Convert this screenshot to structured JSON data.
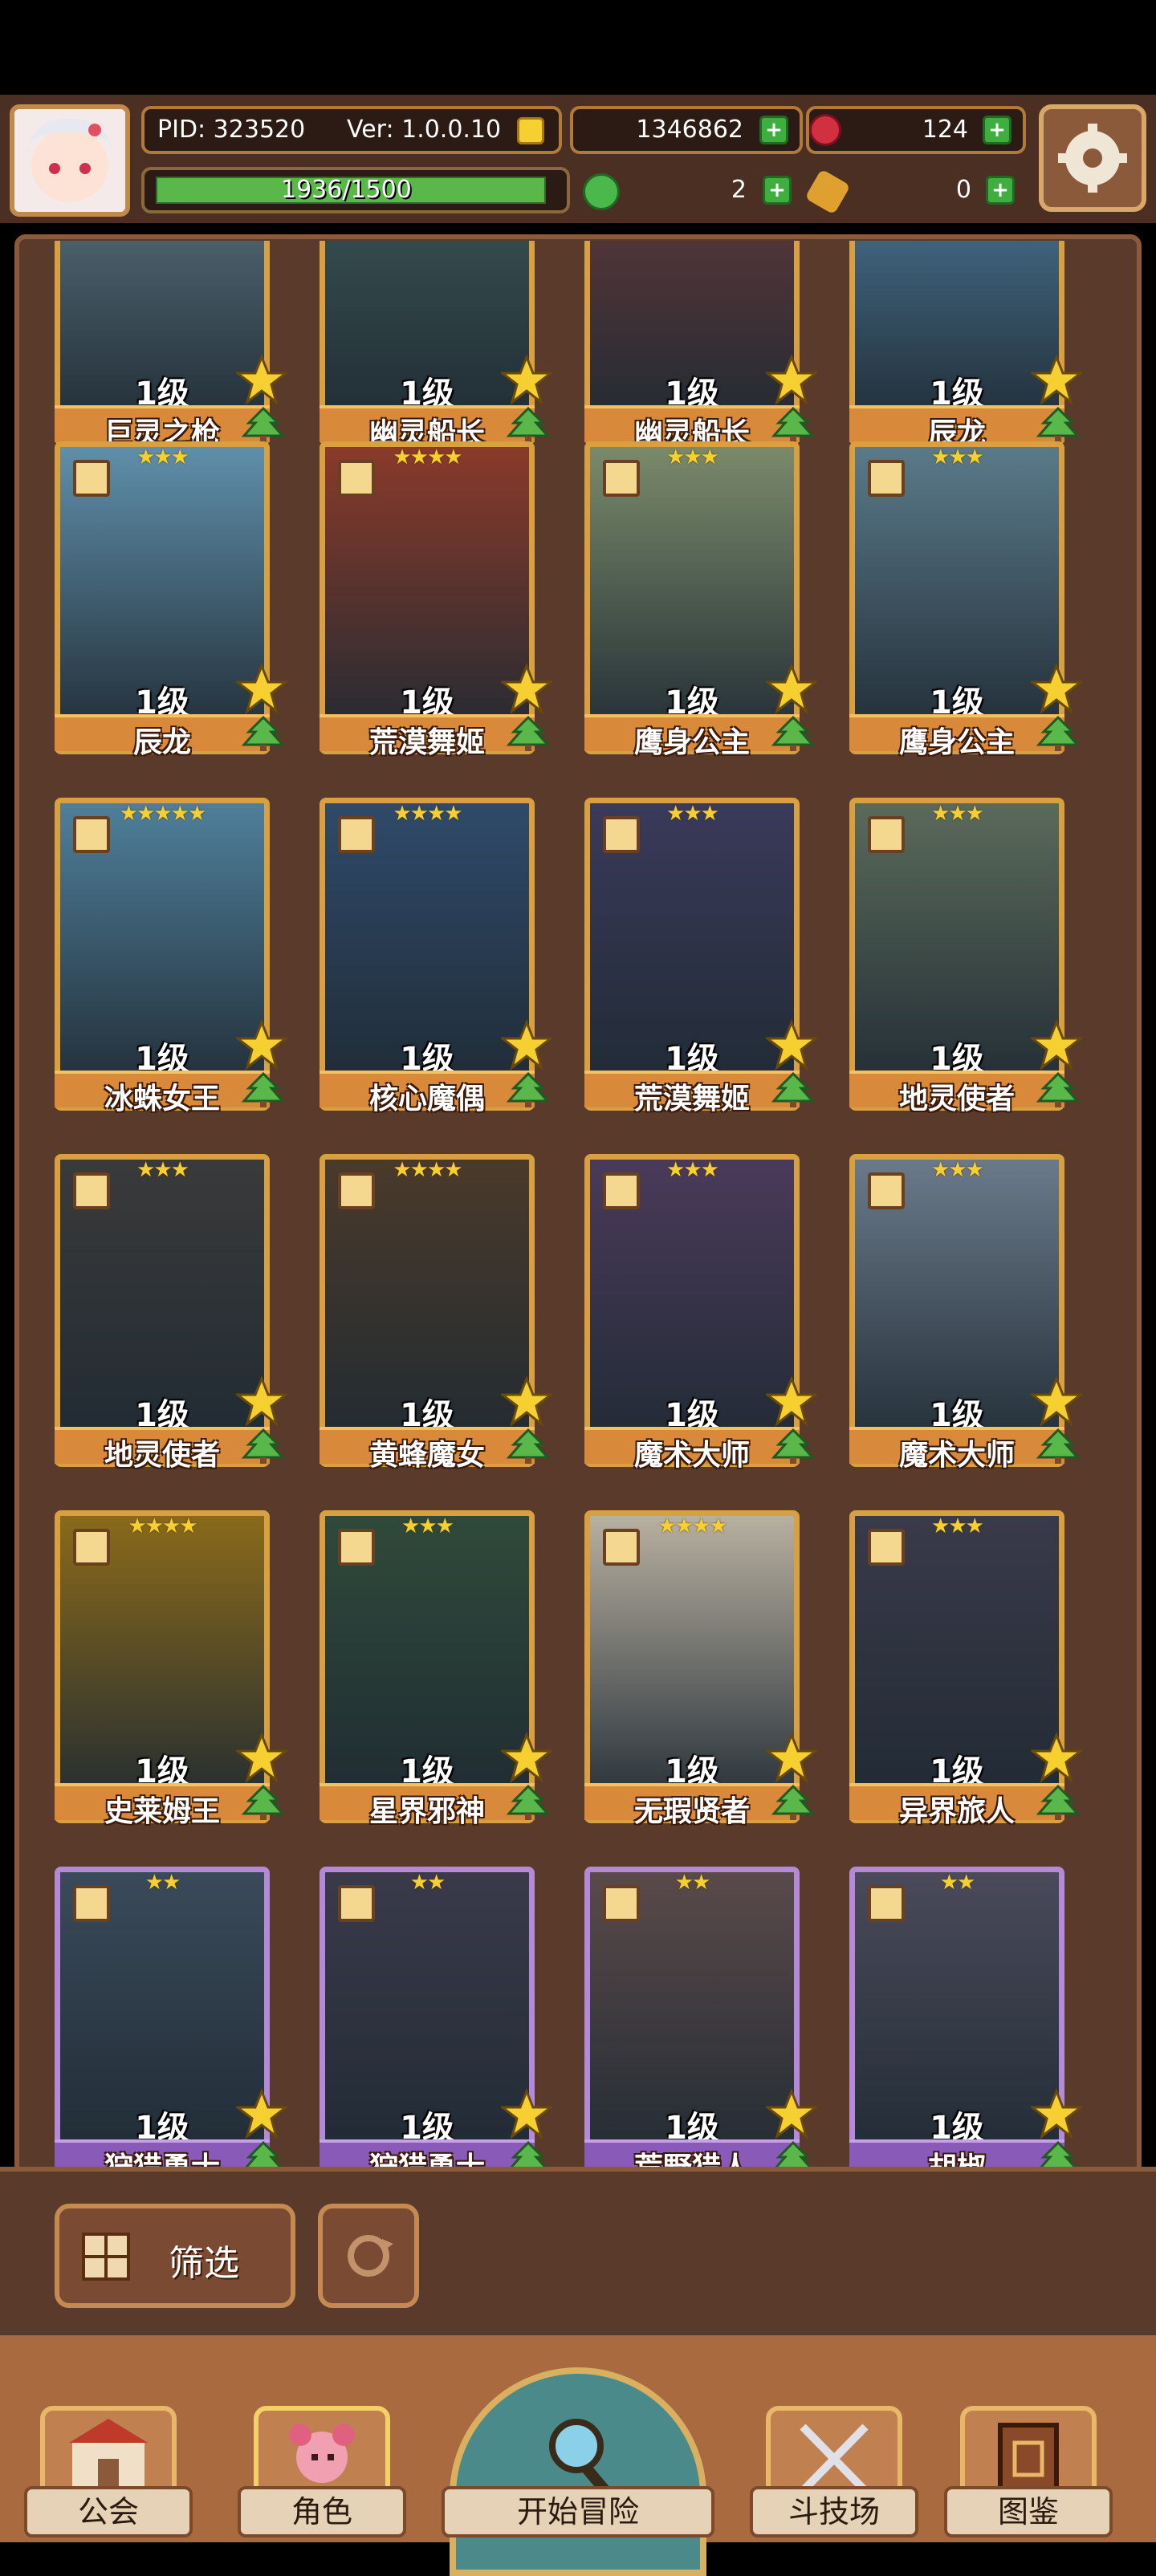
{
  "header": {
    "pid": "PID: 323520",
    "version": "Ver: 1.0.0.10",
    "gold": "1346862",
    "gems": "124",
    "exp": "1936/1500",
    "clover": "2",
    "item": "0",
    "exp_fraction": 1.0
  },
  "cards": [
    {
      "level": "1级",
      "name": "巨灵之枪",
      "stars": "",
      "purple": false,
      "bg": "#5f7a86"
    },
    {
      "level": "1级",
      "name": "幽灵船长",
      "stars": "",
      "purple": false,
      "bg": "#3e5b58"
    },
    {
      "level": "1级",
      "name": "幽灵船长",
      "stars": "",
      "purple": false,
      "bg": "#6a3a3a"
    },
    {
      "level": "1级",
      "name": "辰龙",
      "stars": "",
      "purple": false,
      "bg": "#4f7fa0"
    },
    {
      "level": "1级",
      "name": "辰龙",
      "stars": "★★★",
      "purple": false,
      "bg": "#5f8faa"
    },
    {
      "level": "1级",
      "name": "荒漠舞姬",
      "stars": "★★★★",
      "purple": false,
      "bg": "#8a3a2a"
    },
    {
      "level": "1级",
      "name": "鹰身公主",
      "stars": "★★★",
      "purple": false,
      "bg": "#7a8a6a"
    },
    {
      "level": "1级",
      "name": "鹰身公主",
      "stars": "★★★",
      "purple": false,
      "bg": "#5a7a8a"
    },
    {
      "level": "1级",
      "name": "冰蛛女王",
      "stars": "★★★★★",
      "purple": false,
      "bg": "#4f7f9a"
    },
    {
      "level": "1级",
      "name": "核心魔偶",
      "stars": "★★★★",
      "purple": false,
      "bg": "#2f4a6a"
    },
    {
      "level": "1级",
      "name": "荒漠舞姬",
      "stars": "★★★",
      "purple": false,
      "bg": "#3a3a5a"
    },
    {
      "level": "1级",
      "name": "地灵使者",
      "stars": "★★★",
      "purple": false,
      "bg": "#5a6a5a"
    },
    {
      "level": "1级",
      "name": "地灵使者",
      "stars": "★★★",
      "purple": false,
      "bg": "#3a3a3a"
    },
    {
      "level": "1级",
      "name": "黄蜂魔女",
      "stars": "★★★★",
      "purple": false,
      "bg": "#4a3a2a"
    },
    {
      "level": "1级",
      "name": "魔术大师",
      "stars": "★★★",
      "purple": false,
      "bg": "#4a3a5a"
    },
    {
      "level": "1级",
      "name": "魔术大师",
      "stars": "★★★",
      "purple": false,
      "bg": "#6a7a8a"
    },
    {
      "level": "1级",
      "name": "史莱姆王",
      "stars": "★★★★",
      "purple": false,
      "bg": "#8a6a1a"
    },
    {
      "level": "1级",
      "name": "星界邪神",
      "stars": "★★★",
      "purple": false,
      "bg": "#2f4a3a"
    },
    {
      "level": "1级",
      "name": "无瑕贤者",
      "stars": "★★★★",
      "purple": false,
      "bg": "#b8b0a0"
    },
    {
      "level": "1级",
      "name": "异界旅人",
      "stars": "★★★",
      "purple": false,
      "bg": "#3a3a4a"
    },
    {
      "level": "1级",
      "name": "狩猎勇士",
      "stars": "★★",
      "purple": true,
      "bg": "#3a4a5a"
    },
    {
      "level": "1级",
      "name": "狩猎勇士",
      "stars": "★★",
      "purple": true,
      "bg": "#3a3a4a"
    },
    {
      "level": "1级",
      "name": "荒野猎人",
      "stars": "★★",
      "purple": true,
      "bg": "#5a4a4a"
    },
    {
      "level": "1级",
      "name": "胡椒",
      "stars": "★★",
      "purple": true,
      "bg": "#4a4a5a"
    }
  ],
  "filter": {
    "label": "筛选"
  },
  "nav": {
    "guild": "公会",
    "character": "角色",
    "start": "开始冒险",
    "arena": "斗技场",
    "codex": "图鉴"
  },
  "colors": {
    "gold_border": "#d8a040",
    "purple_border": "#b48ad8",
    "panel": "#5a3a2a"
  }
}
